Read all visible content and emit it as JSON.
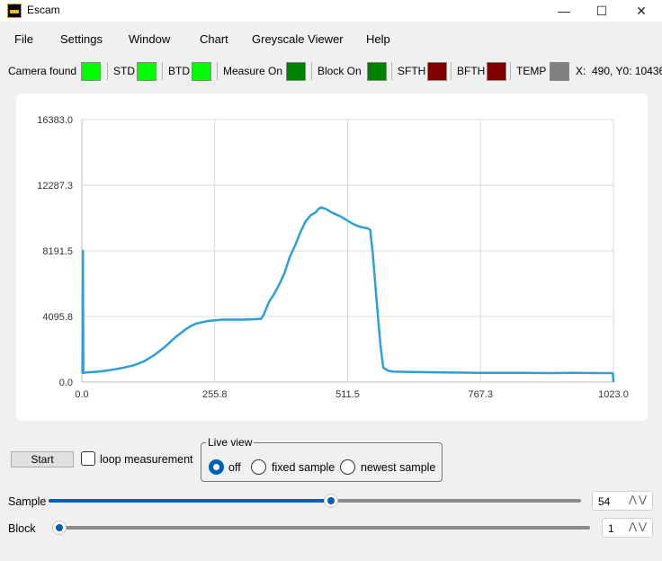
{
  "window": {
    "title": "Escam",
    "minimize_icon": "minimize-icon",
    "maximize_icon": "maximize-icon",
    "close_icon": "close-icon"
  },
  "menu": {
    "items": [
      "File",
      "Settings",
      "Window",
      "Chart",
      "Greyscale Viewer",
      "Help"
    ]
  },
  "status": {
    "camera_found": {
      "label": "Camera found",
      "color": "#00ff00"
    },
    "std": {
      "label": "STD",
      "color": "#00ff00"
    },
    "btd": {
      "label": "BTD",
      "color": "#00ff00"
    },
    "measure_on": {
      "label": "Measure On",
      "color": "#008000"
    },
    "block_on": {
      "label": "Block On",
      "color": "#008000"
    },
    "sfth": {
      "label": "SFTH",
      "color": "#800000"
    },
    "bfth": {
      "label": "BFTH",
      "color": "#800000"
    },
    "temp": {
      "label": "TEMP",
      "color": "#808080"
    },
    "coords": "X:  490, Y0: 10436"
  },
  "chart_data": {
    "type": "line",
    "y_ticks": [
      "16383.0",
      "12287.3",
      "8191.5",
      "4095.8",
      "0.0"
    ],
    "x_ticks": [
      "0.0",
      "255.8",
      "511.5",
      "767.3",
      "1023.0"
    ],
    "xlim": [
      0,
      1023
    ],
    "ylim": [
      0,
      16383
    ],
    "grid": true,
    "line_color": "#2e9fd8",
    "series": [
      {
        "x": [
          0,
          1,
          2,
          3,
          4,
          5,
          6,
          8,
          10,
          20,
          40,
          60,
          80,
          100,
          120,
          140,
          160,
          180,
          200,
          210,
          220,
          240,
          255,
          270,
          290,
          310,
          330,
          345,
          350,
          355,
          360,
          370,
          380,
          390,
          400,
          410,
          420,
          430,
          440,
          445,
          450,
          455,
          460,
          470,
          480,
          490,
          500,
          510,
          520,
          530,
          540,
          550,
          555,
          560,
          565,
          570,
          575,
          580,
          590,
          600,
          650,
          700,
          767,
          800,
          850,
          900,
          950,
          1000,
          1020,
          1022,
          1023
        ],
        "y": [
          560,
          560,
          8191,
          600,
          580,
          570,
          590,
          600,
          600,
          620,
          680,
          780,
          900,
          1050,
          1300,
          1700,
          2200,
          2800,
          3300,
          3500,
          3650,
          3800,
          3850,
          3900,
          3900,
          3900,
          3920,
          3950,
          4200,
          4600,
          5000,
          5500,
          6100,
          6800,
          7800,
          8500,
          9300,
          10000,
          10400,
          10500,
          10600,
          10800,
          10900,
          10800,
          10600,
          10450,
          10300,
          10100,
          9900,
          9750,
          9650,
          9600,
          9500,
          8000,
          6000,
          4000,
          2200,
          900,
          700,
          650,
          620,
          600,
          580,
          580,
          570,
          560,
          580,
          560,
          560,
          550,
          0
        ]
      }
    ]
  },
  "controls": {
    "start_label": "Start",
    "loop_label": "loop measurement",
    "loop_checked": false,
    "live_view": {
      "title": "Live view",
      "options": [
        "off",
        "fixed sample",
        "newest sample"
      ],
      "selected": "off"
    },
    "sample": {
      "label": "Sample",
      "value": "54",
      "fraction": 0.53
    },
    "block": {
      "label": "Block",
      "value": "1",
      "fraction": 0.0
    }
  }
}
